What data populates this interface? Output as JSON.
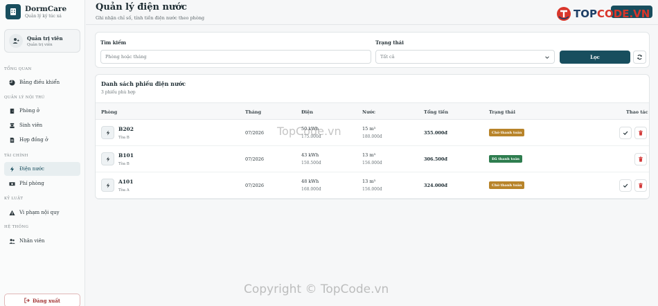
{
  "brand": {
    "name": "DormCare",
    "subtitle": "Quản lý ký túc xá"
  },
  "user": {
    "name": "Quản trị viên",
    "role": "Quản trị viên"
  },
  "nav": {
    "sections": [
      {
        "label": "TỔNG QUAN",
        "items": [
          {
            "label": "Bảng điều khiển",
            "icon": "chart-pie-icon"
          }
        ]
      },
      {
        "label": "QUẢN LÝ NỘI TRÚ",
        "items": [
          {
            "label": "Phòng ở",
            "icon": "door-icon"
          },
          {
            "label": "Sinh viên",
            "icon": "student-icon"
          },
          {
            "label": "Hợp đồng ở",
            "icon": "contract-icon"
          }
        ]
      },
      {
        "label": "TÀI CHÍNH",
        "items": [
          {
            "label": "Điện nước",
            "icon": "bolt-icon",
            "active": true
          },
          {
            "label": "Phí phòng",
            "icon": "money-icon"
          }
        ]
      },
      {
        "label": "KỶ LUẬT",
        "items": [
          {
            "label": "Vi phạm nội quy",
            "icon": "warning-icon"
          }
        ]
      },
      {
        "label": "HỆ THỐNG",
        "items": [
          {
            "label": "Nhân viên",
            "icon": "users-icon"
          }
        ]
      }
    ],
    "logout": "Đăng xuất"
  },
  "header": {
    "title": "Quản lý điện nước",
    "subtitle": "Ghi nhận chỉ số, tính tiền điện nước theo phòng"
  },
  "filters": {
    "search_label": "Tìm kiếm",
    "search_placeholder": "Phòng hoặc tháng",
    "status_label": "Trạng thái",
    "status_value": "Tất cả",
    "filter_button": "Lọc"
  },
  "list": {
    "title": "Danh sách phiếu điện nước",
    "count": "3 phiếu phù hợp",
    "columns": [
      "Phòng",
      "Tháng",
      "Điện",
      "Nước",
      "Tổng tiền",
      "Trạng thái",
      "Thao tác"
    ],
    "rows": [
      {
        "room": "B202",
        "block": "Tòa B",
        "month": "07/2026",
        "electric": "50 kWh",
        "electric_cost": "175.000đ",
        "water": "15 m³",
        "water_cost": "180.000đ",
        "total": "355.000đ",
        "status": "Chờ thanh toán",
        "paid": false
      },
      {
        "room": "B101",
        "block": "Tòa B",
        "month": "07/2026",
        "electric": "43 kWh",
        "electric_cost": "150.500đ",
        "water": "13 m³",
        "water_cost": "156.000đ",
        "total": "306.500đ",
        "status": "Đã thanh toán",
        "paid": true
      },
      {
        "room": "A101",
        "block": "Tòa A",
        "month": "07/2026",
        "electric": "48 kWh",
        "electric_cost": "168.000đ",
        "water": "13 m³",
        "water_cost": "156.000đ",
        "total": "324.000đ",
        "status": "Chờ thanh toán",
        "paid": false
      }
    ]
  },
  "colors": {
    "primary": "#184e5e",
    "pending": "#b8842a",
    "paid": "#2e7d4f",
    "danger": "#d23a3a"
  },
  "branding": {
    "logo_text_1": "TOP",
    "logo_text_2": "CODE.VN",
    "watermark_top": "TopCode.vn",
    "watermark_bottom": "Copyright © TopCode.vn"
  }
}
